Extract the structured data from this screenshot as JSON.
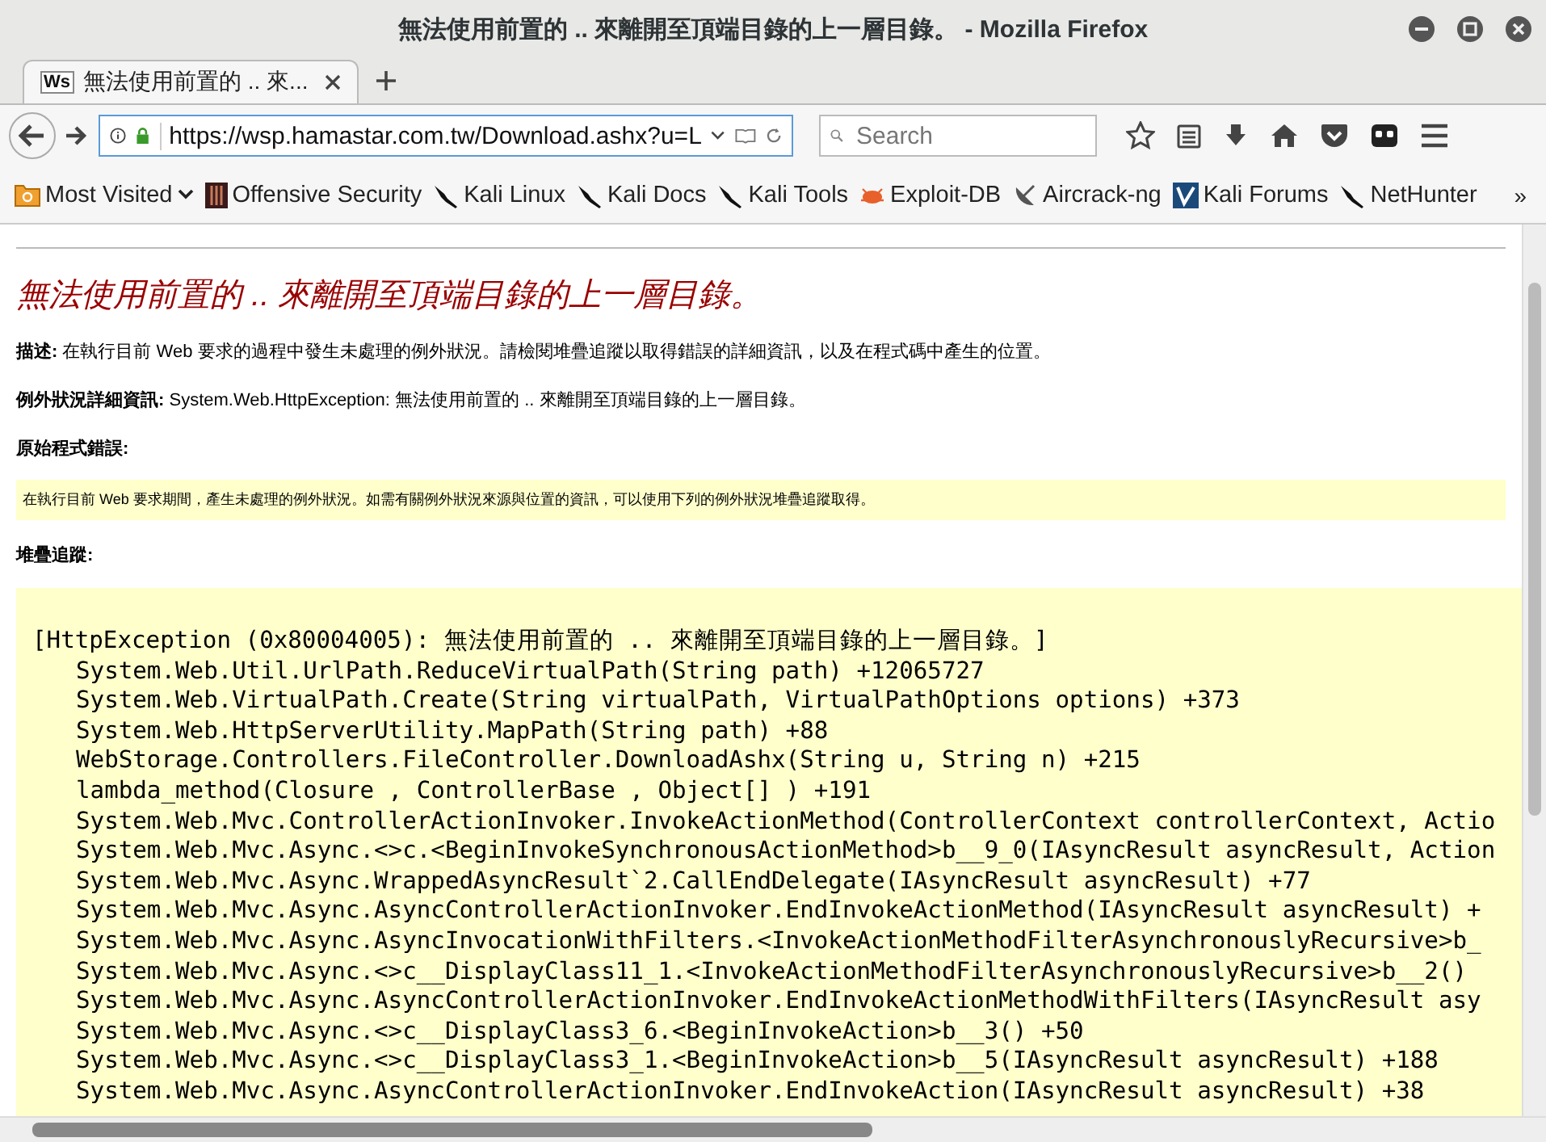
{
  "window": {
    "title": "無法使用前置的 .. 來離開至頂端目錄的上一層目錄。 - Mozilla Firefox"
  },
  "tabs": [
    {
      "favicon": "Ws",
      "label": "無法使用前置的 .. 來...",
      "selected": true
    }
  ],
  "url": "https://wsp.hamastar.com.tw/Download.ashx?u=L",
  "search": {
    "placeholder": "Search"
  },
  "bookmarks": [
    {
      "label": "Most Visited",
      "kind": "folder"
    },
    {
      "label": "Offensive Security",
      "kind": "offsec"
    },
    {
      "label": "Kali Linux",
      "kind": "kali"
    },
    {
      "label": "Kali Docs",
      "kind": "kali"
    },
    {
      "label": "Kali Tools",
      "kind": "kali"
    },
    {
      "label": "Exploit-DB",
      "kind": "exploit"
    },
    {
      "label": "Aircrack-ng",
      "kind": "aircrack"
    },
    {
      "label": "Kali Forums",
      "kind": "forums"
    },
    {
      "label": "NetHunter",
      "kind": "kali"
    }
  ],
  "overflow": "»",
  "page": {
    "heading": "無法使用前置的 .. 來離開至頂端目錄的上一層目錄。",
    "description": "**描述:** 在執行目前 Web 要求的過程中發生未處理的例外狀況。請檢閱堆疊追蹤以取得錯誤的詳細資訊，以及在程式碼中產生的位置。",
    "exception": "**例外狀況詳細資訊:** System.Web.HttpException: 無法使用前置的 .. 來離開至頂端目錄的上一層目錄。",
    "source_label": "原始程式錯誤:",
    "source_note": "在執行目前 Web 要求期間，產生未處理的例外狀況。如需有關例外狀況來源與位置的資訊，可以使用下列的例外狀況堆疊追蹤取得。",
    "stack_label": "堆疊追蹤:",
    "stack": [
      {
        "kind": "header",
        "text": "[HttpException (0x80004005): 無法使用前置的 .. 來離開至頂端目錄的上一層目錄。]"
      },
      {
        "kind": "frame",
        "text": "System.Web.Util.UrlPath.ReduceVirtualPath(String path) +12065727"
      },
      {
        "kind": "frame",
        "text": "System.Web.VirtualPath.Create(String virtualPath, VirtualPathOptions options) +373"
      },
      {
        "kind": "frame",
        "text": "System.Web.HttpServerUtility.MapPath(String path) +88"
      },
      {
        "kind": "frame",
        "text": "WebStorage.Controllers.FileController.DownloadAshx(String u, String n) +215"
      },
      {
        "kind": "frame",
        "text": "lambda_method(Closure , ControllerBase , Object[] ) +191"
      },
      {
        "kind": "frame",
        "text": "System.Web.Mvc.ControllerActionInvoker.InvokeActionMethod(ControllerContext controllerContext, Actio"
      },
      {
        "kind": "frame",
        "text": "System.Web.Mvc.Async.<>c.<BeginInvokeSynchronousActionMethod>b__9_0(IAsyncResult asyncResult, Action"
      },
      {
        "kind": "frame",
        "text": "System.Web.Mvc.Async.WrappedAsyncResult`2.CallEndDelegate(IAsyncResult asyncResult) +77"
      },
      {
        "kind": "frame",
        "text": "System.Web.Mvc.Async.AsyncControllerActionInvoker.EndInvokeActionMethod(IAsyncResult asyncResult) +"
      },
      {
        "kind": "frame",
        "text": "System.Web.Mvc.Async.AsyncInvocationWithFilters.<InvokeActionMethodFilterAsynchronouslyRecursive>b_"
      },
      {
        "kind": "frame",
        "text": "System.Web.Mvc.Async.<>c__DisplayClass11_1.<InvokeActionMethodFilterAsynchronouslyRecursive>b__2()"
      },
      {
        "kind": "frame",
        "text": "System.Web.Mvc.Async.AsyncControllerActionInvoker.EndInvokeActionMethodWithFilters(IAsyncResult asy"
      },
      {
        "kind": "frame",
        "text": "System.Web.Mvc.Async.<>c__DisplayClass3_6.<BeginInvokeAction>b__3() +50"
      },
      {
        "kind": "frame",
        "text": "System.Web.Mvc.Async.<>c__DisplayClass3_1.<BeginInvokeAction>b__5(IAsyncResult asyncResult) +188"
      },
      {
        "kind": "frame",
        "text": "System.Web.Mvc.Async.AsyncControllerActionInvoker.EndInvokeAction(IAsyncResult asyncResult) +38"
      }
    ]
  }
}
